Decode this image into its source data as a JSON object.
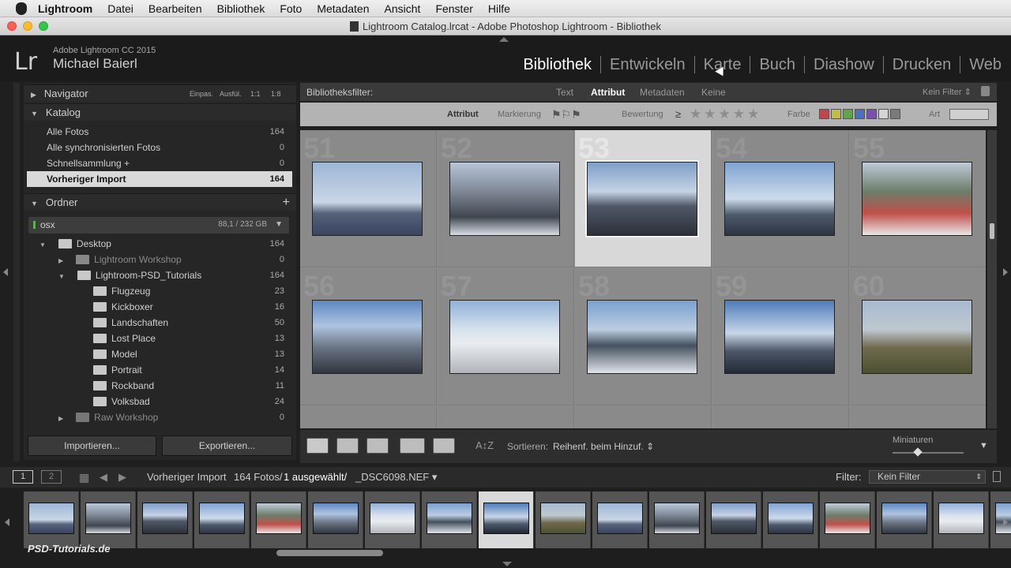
{
  "menubar": {
    "items": [
      "Lightroom",
      "Datei",
      "Bearbeiten",
      "Bibliothek",
      "Foto",
      "Metadaten",
      "Ansicht",
      "Fenster",
      "Hilfe"
    ]
  },
  "window": {
    "title": "Lightroom Catalog.lrcat - Adobe Photoshop Lightroom - Bibliothek"
  },
  "identity": {
    "logo": "Lr",
    "version": "Adobe Lightroom CC 2015",
    "user": "Michael Baierl"
  },
  "modules": [
    "Bibliothek",
    "Entwickeln",
    "Karte",
    "Buch",
    "Diashow",
    "Drucken",
    "Web"
  ],
  "navigator": {
    "title": "Navigator",
    "zooms": [
      "Einpas.",
      "Ausfül.",
      "1:1",
      "1:8"
    ]
  },
  "catalog": {
    "title": "Katalog",
    "items": [
      {
        "label": "Alle Fotos",
        "count": "164"
      },
      {
        "label": "Alle synchronisierten Fotos",
        "count": "0"
      },
      {
        "label": "Schnellsammlung +",
        "count": "0"
      },
      {
        "label": "Vorheriger Import",
        "count": "164"
      }
    ]
  },
  "folders": {
    "title": "Ordner",
    "add": "+",
    "volume": {
      "name": "osx",
      "size": "88,1 / 232 GB"
    },
    "items": [
      {
        "label": "Desktop",
        "count": "164"
      },
      {
        "label": "Lightroom Workshop",
        "count": "0"
      },
      {
        "label": "Lightroom-PSD_Tutorials",
        "count": "164"
      },
      {
        "label": "Flugzeug",
        "count": "23"
      },
      {
        "label": "Kickboxer",
        "count": "16"
      },
      {
        "label": "Landschaften",
        "count": "50"
      },
      {
        "label": "Lost Place",
        "count": "13"
      },
      {
        "label": "Model",
        "count": "13"
      },
      {
        "label": "Portrait",
        "count": "14"
      },
      {
        "label": "Rockband",
        "count": "11"
      },
      {
        "label": "Volksbad",
        "count": "24"
      },
      {
        "label": "Raw Workshop",
        "count": "0"
      }
    ]
  },
  "buttons": {
    "import": "Importieren...",
    "export": "Exportieren..."
  },
  "filterbar": {
    "title": "Bibliotheksfilter:",
    "tabs": [
      "Text",
      "Attribut",
      "Metadaten",
      "Keine"
    ],
    "preset": "Kein Filter"
  },
  "attrbar": {
    "label": "Attribut",
    "flag": "Markierung",
    "rating": "Bewertung",
    "rating_op": "≥",
    "color": "Farbe",
    "kind": "Art",
    "color_swatches": [
      "#c0454f",
      "#c2bd45",
      "#62a44b",
      "#4d6fbf",
      "#7a4fae",
      "#d4d4d4",
      "#7a7a7a"
    ]
  },
  "grid": {
    "numbers": [
      "51",
      "52",
      "53",
      "54",
      "55",
      "56",
      "57",
      "58",
      "59",
      "60"
    ],
    "selected_index": 2
  },
  "toolbar": {
    "sort_label": "Sortieren:",
    "sort_value": "Reihenf. beim Hinzuf.",
    "thumbs_label": "Miniaturen"
  },
  "filmbar": {
    "page1": "1",
    "page2": "2",
    "source": "Vorheriger Import",
    "count": "164 Fotos/",
    "selected": "1 ausgewählt/",
    "filename": "_DSC6098.NEF",
    "filter_label": "Filter:",
    "filter_value": "Kein Filter"
  },
  "watermark": "PSD-Tutorials.de"
}
